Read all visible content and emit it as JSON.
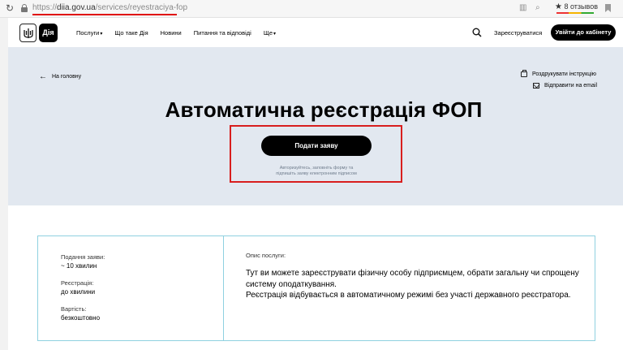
{
  "browser": {
    "url_scheme": "https://",
    "url_host": "diia.gov.ua",
    "url_path": "/services/reyestraciya-fop",
    "reviews_label": "8 отзывов",
    "reviews_star": "★"
  },
  "header": {
    "logo_text": "Дія",
    "nav": [
      {
        "label": "Послуги",
        "caret": "▾"
      },
      {
        "label": "Що таке Дія",
        "caret": ""
      },
      {
        "label": "Новини",
        "caret": ""
      },
      {
        "label": "Питання та відповіді",
        "caret": ""
      },
      {
        "label": "Ще",
        "caret": "▾"
      }
    ],
    "register_label": "Зареєструватися",
    "login_label": "Увійти до кабінету"
  },
  "hero": {
    "back_label": "На головну",
    "print_label": "Роздрукувати інструкцію",
    "email_label": "Відправити на email",
    "title": "Автоматична реєстрація ФОП",
    "apply_label": "Подати заяву",
    "apply_hint_line1": "Авторизуйтесь, заповніть форму та",
    "apply_hint_line2": "підпишіть заяву електронним підписом"
  },
  "info": {
    "items": [
      {
        "key": "Подання заяви:",
        "value": "~ 10 хвилин"
      },
      {
        "key": "Реєстрація:",
        "value": "до хвилини"
      },
      {
        "key": "Вартість:",
        "value": "безкоштовно"
      }
    ],
    "description_label": "Опис послуги:",
    "description_p1": "Тут ви можете зареєструвати фізичну особу підприємцем, обрати загальну чи спрощену систему оподаткування.",
    "description_p2": "Реєстрація відбувається в автоматичному режимі без участі державного реєстратора."
  },
  "colors": {
    "hero_bg": "#e2e8f0",
    "highlight": "#d81e1e",
    "card_border": "#8fd1e0",
    "button_bg": "#000000"
  }
}
